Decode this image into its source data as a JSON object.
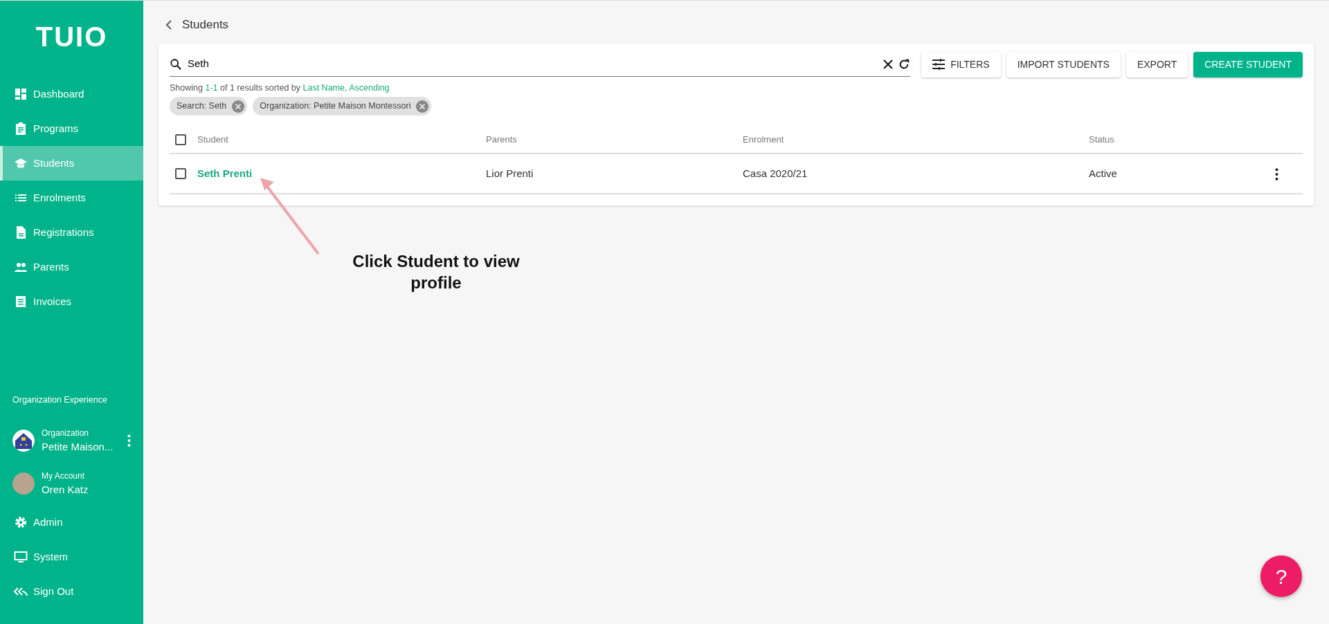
{
  "sidebar": {
    "logo": "TUIO",
    "items": [
      {
        "label": "Dashboard",
        "selected": false
      },
      {
        "label": "Programs",
        "selected": false
      },
      {
        "label": "Students",
        "selected": true
      },
      {
        "label": "Enrolments",
        "selected": false
      },
      {
        "label": "Registrations",
        "selected": false
      },
      {
        "label": "Parents",
        "selected": false
      },
      {
        "label": "Invoices",
        "selected": false
      }
    ],
    "section_title": "Organization Experience",
    "accounts": [
      {
        "kind": "organization",
        "caption": "Organization",
        "name": "Petite Maison..."
      },
      {
        "kind": "person",
        "caption": "My Account",
        "name": "Oren Katz"
      }
    ],
    "bottom_items": [
      {
        "label": "Admin"
      },
      {
        "label": "System"
      },
      {
        "label": "Sign Out"
      }
    ]
  },
  "page": {
    "title": "Students"
  },
  "search": {
    "value": "Seth"
  },
  "actions": [
    {
      "label": "FILTERS",
      "kind": "filter"
    },
    {
      "label": "IMPORT STUDENTS",
      "kind": "plain"
    },
    {
      "label": "EXPORT",
      "kind": "plain"
    },
    {
      "label": "CREATE STUDENT",
      "kind": "primary"
    }
  ],
  "summary": [
    {
      "text": "Showing ",
      "kind": "plain"
    },
    {
      "text": "1-1",
      "kind": "highlight"
    },
    {
      "text": " of 1 results sorted by ",
      "kind": "plain"
    },
    {
      "text": "Last Name, Ascending",
      "kind": "highlight"
    }
  ],
  "chips": [
    "Search: Seth",
    "Organization: Petite Maison Montessori"
  ],
  "table": {
    "all_checked": false,
    "columns": [
      "Student",
      "Parents",
      "Enrolment",
      "Status"
    ],
    "rows": [
      {
        "checked": false,
        "cells": [
          "Seth Prenti",
          "Lior Prenti",
          "Casa 2020/21",
          "Active"
        ]
      }
    ]
  },
  "annotation": {
    "text": "Click Student to view profile"
  },
  "help_button": {
    "label": "?"
  }
}
